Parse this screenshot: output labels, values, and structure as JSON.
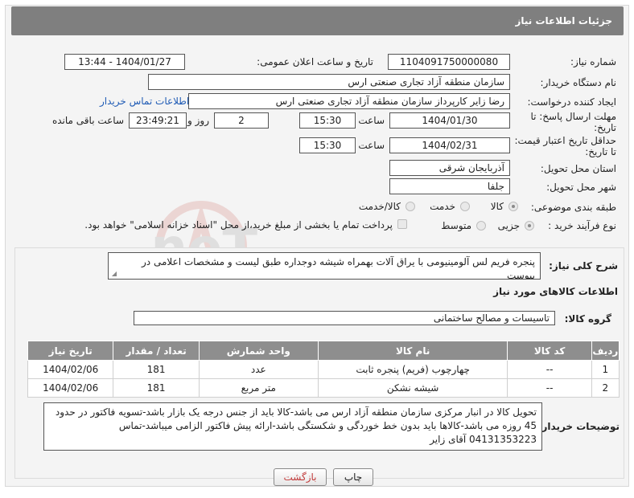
{
  "header": {
    "title": "جزئیات اطلاعات نیاز"
  },
  "fields": {
    "need_number_label": "شماره نیاز:",
    "need_number": "1104091750000080",
    "announce_label": "تاریخ و ساعت اعلان عمومی:",
    "announce_value": "1404/01/27 - 13:44",
    "buyer_org_label": "نام دستگاه خریدار:",
    "buyer_org": "سازمان منطقه آزاد تجاری صنعتی ارس",
    "requester_label": "ایجاد کننده درخواست:",
    "requester": "رضا زایر کارپرداز سازمان منطقه آزاد تجاری صنعتی ارس",
    "buyer_contact_link": "اطلاعات تماس خریدار",
    "reply_deadline_label_1": "مهلت ارسال پاسخ: تا",
    "reply_deadline_label_2": "تاریخ:",
    "reply_date": "1404/01/30",
    "time_label": "ساعت",
    "reply_time": "15:30",
    "days_value": "2",
    "days_label": "روز و",
    "remaining_time": "23:49:21",
    "remaining_label": "ساعت باقی مانده",
    "validity_label_1": "حداقل تاریخ اعتبار قیمت:",
    "validity_label_2": "تا تاریخ:",
    "validity_date": "1404/02/31",
    "validity_time_label": "ساعت",
    "validity_time": "15:30",
    "province_label": "استان محل تحویل:",
    "province": "آذربایجان شرقی",
    "city_label": "شهر محل تحویل:",
    "city": "جلفا",
    "category_label": "طبقه بندی موضوعی:",
    "category_options": [
      "کالا",
      "خدمت",
      "کالا/خدمت"
    ],
    "category_selected": "کالا",
    "process_label": "نوع فرآیند خرید :",
    "process_options": [
      "جزیی",
      "متوسط"
    ],
    "process_selected": "جزیی",
    "payment_note": "پرداخت تمام یا بخشی از مبلغ خرید،از محل \"اسناد خزانه اسلامی\" خواهد بود."
  },
  "description": {
    "label": "شرح کلی نیاز:",
    "text": "پنجره فریم لس آلومینیومی با یراق آلات بهمراه شیشه دوجداره طبق لیست و مشخصات اعلامی در پیوست"
  },
  "goods": {
    "section_title": "اطلاعات کالاهای مورد نیاز",
    "group_label": "گروه کالا:",
    "group_value": "تاسیسات و مصالح ساختمانی",
    "columns": [
      "ردیف",
      "کد کالا",
      "نام کالا",
      "واحد شمارش",
      "تعداد / مقدار",
      "تاریخ نیاز"
    ],
    "rows": [
      {
        "index": "1",
        "code": "--",
        "name": "چهارچوب (فریم) پنجره ثابت",
        "unit": "عدد",
        "qty": "181",
        "date": "1404/02/06"
      },
      {
        "index": "2",
        "code": "--",
        "name": "شیشه نشکن",
        "unit": "متر مربع",
        "qty": "181",
        "date": "1404/02/06"
      }
    ]
  },
  "buyer_notes": {
    "label": "توضیحات خریدار:",
    "text": "تحویل کالا در انبار مرکزی سازمان منطقه آزاد ارس می باشد-کالا باید از جنس درجه یک بازار باشد-تسویه فاکتور در حدود 45 روزه می باشد-کالاها باید بدون خط خوردگی و شکستگی باشد-ارائه پیش فاکتور الزامی میباشد-تماس 04131353223 آقای زایر"
  },
  "buttons": {
    "print": "چاپ",
    "back": "بازگشت"
  },
  "watermark": {
    "text": "AriaTender.neT"
  },
  "colors": {
    "header_bg": "#7f7f7f",
    "link": "#1f5bb5",
    "table_header": "#8e8e8e",
    "back_btn_text": "#c23b3b"
  }
}
